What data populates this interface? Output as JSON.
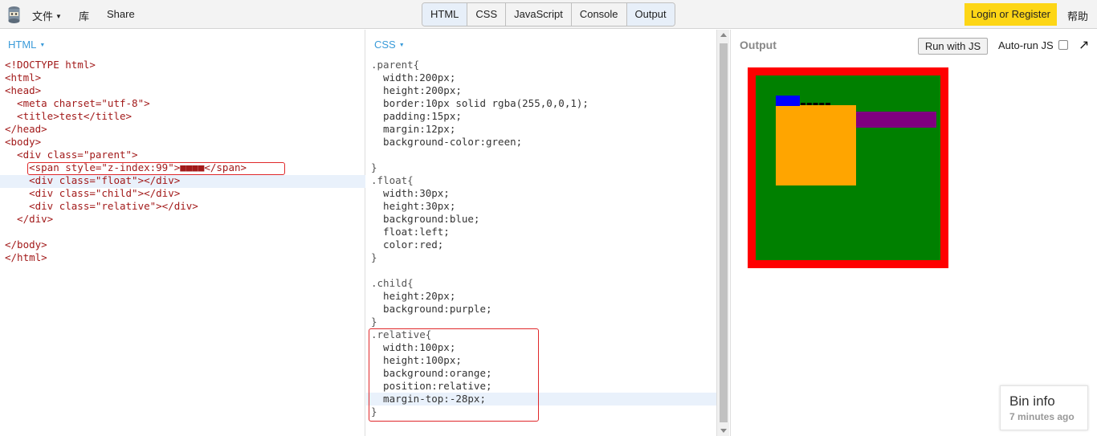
{
  "topbar": {
    "menu": [
      {
        "label": "文件",
        "has_caret": true
      },
      {
        "label": "库",
        "has_caret": false
      },
      {
        "label": "Share",
        "has_caret": false
      }
    ],
    "tabs": [
      {
        "label": "HTML",
        "active": true
      },
      {
        "label": "CSS",
        "active": false
      },
      {
        "label": "JavaScript",
        "active": false
      },
      {
        "label": "Console",
        "active": false
      },
      {
        "label": "Output",
        "active": true
      }
    ],
    "login_label": "Login or Register",
    "help_label": "帮助"
  },
  "html_panel": {
    "label": "HTML",
    "lines": [
      "<!DOCTYPE html>",
      "<html>",
      "<head>",
      "  <meta charset=\"utf-8\">",
      "  <title>test</title>",
      "</head>",
      "<body>",
      "  <div class=\"parent\">",
      "    <span style=\"z-index:99\">■■■■</span>",
      "    <div class=\"float\"></div>",
      "    <div class=\"child\"></div>",
      "    <div class=\"relative\"></div>",
      "  </div>",
      "",
      "</body>",
      "</html>"
    ]
  },
  "css_panel": {
    "label": "CSS",
    "lines": [
      ".parent{",
      "  width:200px;",
      "  height:200px;",
      "  border:10px solid rgba(255,0,0,1);",
      "  padding:15px;",
      "  margin:12px;",
      "  background-color:green;",
      "",
      "}",
      ".float{",
      "  width:30px;",
      "  height:30px;",
      "  background:blue;",
      "  float:left;",
      "  color:red;",
      "}",
      "",
      ".child{",
      "  height:20px;",
      "  background:purple;",
      "}",
      ".relative{",
      "  width:100px;",
      "  height:100px;",
      "  background:orange;",
      "  position:relative;",
      "  margin-top:-28px;",
      "}"
    ]
  },
  "output_panel": {
    "title": "Output",
    "run_label": "Run with JS",
    "autorun_label": "Auto-run JS",
    "autorun_checked": false
  },
  "bin_info": {
    "title": "Bin info",
    "subtitle": "7 minutes ago"
  },
  "colors": {
    "accent_blue": "#3a9bd9",
    "login_yellow": "#fdd616",
    "highlight_red": "#e0282a"
  }
}
